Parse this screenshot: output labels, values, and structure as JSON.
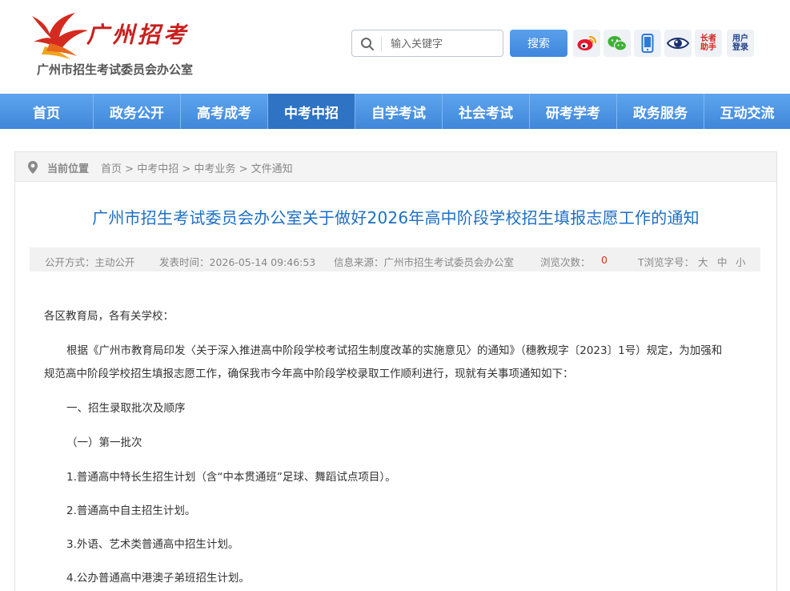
{
  "header": {
    "logo_title": "广州招考",
    "logo_subtitle": "广州市招生考试委员会办公室",
    "search": {
      "placeholder": "输入关键字",
      "button_label": "搜索"
    },
    "tools": {
      "elder_label": "长者助手",
      "login_label": "用户登录"
    }
  },
  "nav": {
    "items": [
      "首页",
      "政务公开",
      "高考成考",
      "中考中招",
      "自学考试",
      "社会考试",
      "研考学考",
      "政务服务",
      "互动交流"
    ],
    "active_index": 3
  },
  "breadcrumb": {
    "label": "当前位置",
    "items": [
      "首页",
      "中考中招",
      "中考业务",
      "文件通知"
    ],
    "separator": ">"
  },
  "article": {
    "title": "广州市招生考试委员会办公室关于做好2026年高中阶段学校招生填报志愿工作的通知",
    "meta": {
      "disclosure": "公开方式：主动公开",
      "published": "发表时间：2026-05-14 09:46:53",
      "source": "信息来源：广州市招生考试委员会办公室",
      "views_label": "浏览次数：",
      "views_value": "0",
      "font_label": "T浏览字号：",
      "font_large": "大",
      "font_medium": "中",
      "font_small": "小"
    },
    "paragraphs": [
      "各区教育局，各有关学校：",
      "根据《广州市教育局印发〈关于深入推进高中阶段学校考试招生制度改革的实施意见〉的通知》（穗教规字〔2023〕1号）规定，为加强和",
      "规范高中阶段学校招生填报志愿工作，确保我市今年高中阶段学校录取工作顺利进行，现就有关事项通知如下：",
      "一、招生录取批次及顺序",
      "（一）第一批次",
      "1.普通高中特长生招生计划（含“中本贯通班”足球、舞蹈试点项目）。",
      "2.普通高中自主招生计划。",
      "3.外语、艺术类普通高中招生计划。",
      "4.公办普通高中港澳子弟班招生计划。"
    ]
  },
  "colors": {
    "nav_bg": "#4a93e3",
    "nav_active": "#2e73c4",
    "title_blue": "#1d6fc4",
    "brand_red": "#c8201e",
    "views_red": "#d03a1a"
  }
}
